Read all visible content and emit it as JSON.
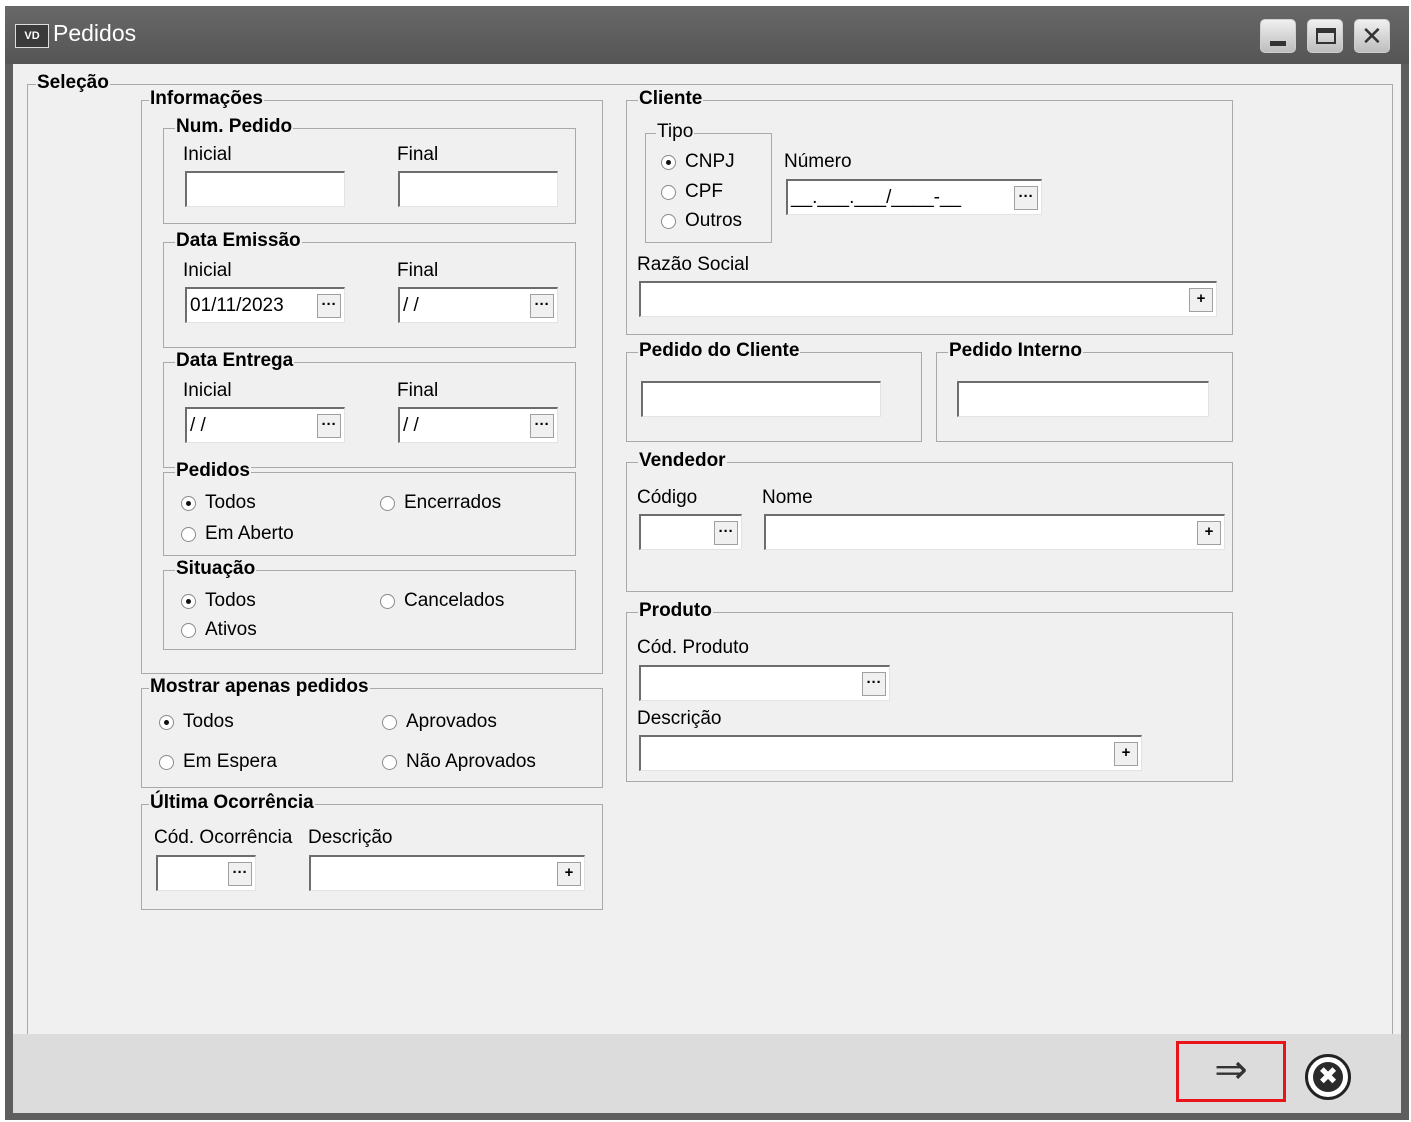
{
  "window": {
    "icon_text": "VD",
    "title": "Pedidos"
  },
  "selecao": {
    "title": "Seleção"
  },
  "informacoes": {
    "title": "Informações",
    "num_pedido": {
      "title": "Num. Pedido",
      "inicial_label": "Inicial",
      "final_label": "Final",
      "inicial_value": "",
      "final_value": ""
    },
    "data_emissao": {
      "title": "Data Emissão",
      "inicial_label": "Inicial",
      "final_label": "Final",
      "inicial_value": "01/11/2023",
      "final_value": " / /"
    },
    "data_entrega": {
      "title": "Data Entrega",
      "inicial_label": "Inicial",
      "final_label": "Final",
      "inicial_value": " / /",
      "final_value": " / /"
    },
    "pedidos": {
      "title": "Pedidos",
      "options": [
        "Todos",
        "Encerrados",
        "Em Aberto"
      ],
      "selected": "Todos"
    },
    "situacao": {
      "title": "Situação",
      "options": [
        "Todos",
        "Cancelados",
        "Ativos"
      ],
      "selected": "Todos"
    }
  },
  "mostrar": {
    "title": "Mostrar apenas pedidos",
    "options": [
      "Todos",
      "Aprovados",
      "Em Espera",
      "Não Aprovados"
    ],
    "selected": "Todos"
  },
  "ultima_ocorrencia": {
    "title": "Última Ocorrência",
    "codigo_label": "Cód. Ocorrência",
    "descricao_label": "Descrição",
    "codigo_value": "",
    "descricao_value": ""
  },
  "cliente": {
    "title": "Cliente",
    "tipo": {
      "title": "Tipo",
      "options": [
        "CNPJ",
        "CPF",
        "Outros"
      ],
      "selected": "CNPJ"
    },
    "numero_label": "Número",
    "numero_mask": "__.___.___/____-__",
    "razao_label": "Razão Social",
    "razao_value": ""
  },
  "pedido_cliente": {
    "title": "Pedido do Cliente",
    "value": ""
  },
  "pedido_interno": {
    "title": "Pedido Interno",
    "value": ""
  },
  "vendedor": {
    "title": "Vendedor",
    "codigo_label": "Código",
    "nome_label": "Nome",
    "codigo_value": "",
    "nome_value": ""
  },
  "produto": {
    "title": "Produto",
    "codigo_label": "Cód. Produto",
    "descricao_label": "Descrição",
    "codigo_value": "",
    "descricao_value": ""
  },
  "buttons": {
    "lookup_glyph": "···",
    "plus_glyph": "+",
    "next_glyph": "⇒",
    "cancel_glyph": "✖"
  },
  "window_buttons": {
    "minimize": "minimize",
    "maximize": "maximize",
    "close_glyph": "✕"
  }
}
